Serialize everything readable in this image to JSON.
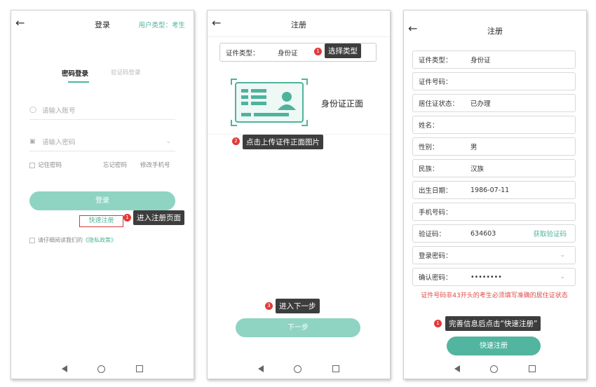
{
  "screen1": {
    "title": "登录",
    "user_type": "用户类型：考生",
    "tab_password": "密码登录",
    "tab_sms": "验证码登录",
    "account_placeholder": "请输入账号",
    "password_placeholder": "请输入密码",
    "remember": "记住密码",
    "forgot": "忘记密码",
    "change_phone": "修改手机号",
    "login_button": "登录",
    "quick_register": "快速注册",
    "privacy_prefix": "请仔细阅读我们的",
    "privacy_link": "《隐私政策》",
    "tip1_num": "1",
    "tip1": "进入注册页面"
  },
  "screen2": {
    "title": "注册",
    "id_type_label": "证件类型：",
    "id_type_value": "身份证",
    "tip1_num": "1",
    "tip1": "选择类型",
    "upload_label": "身份证正面",
    "tip2_num": "2",
    "tip2": "点击上传证件正面图片",
    "tip3_num": "3",
    "tip3": "进入下一步",
    "next_button": "下一步"
  },
  "screen3": {
    "title": "注册",
    "rows": [
      {
        "label": "证件类型：",
        "value": "身份证"
      },
      {
        "label": "证件号码：",
        "value": ""
      },
      {
        "label": "居住证状态：",
        "value": "已办理"
      },
      {
        "label": "姓名：",
        "value": ""
      },
      {
        "label": "性别：",
        "value": "男"
      },
      {
        "label": "民族：",
        "value": "汉族"
      },
      {
        "label": "出生日期：",
        "value": "1986-07-11"
      },
      {
        "label": "手机号码：",
        "value": ""
      },
      {
        "label": "验证码：",
        "value": "634603",
        "action": "获取验证码"
      },
      {
        "label": "登录密码：",
        "value": ""
      },
      {
        "label": "确认密码：",
        "value": "••••••••"
      }
    ],
    "warning": "证件号码非43开头的考生必须填写准确的居住证状态",
    "tip1_num": "1",
    "tip1": "完善信息后点击“快速注册”",
    "register_button": "快速注册"
  },
  "colors": {
    "teal": "#4fb39c",
    "teal_light": "#8fd3c3",
    "tip_bg": "#3d3d3d",
    "badge": "#e23a3a",
    "warning": "#e04a4a"
  },
  "icons": [
    "back-arrow-icon",
    "user-icon",
    "lock-icon",
    "chevron-down-icon",
    "id-card-icon",
    "nav-back-icon",
    "nav-home-icon",
    "nav-recent-icon"
  ]
}
